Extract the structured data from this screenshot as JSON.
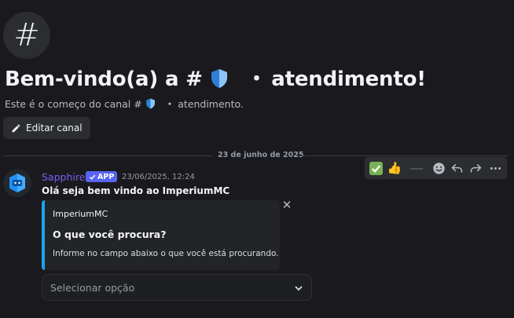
{
  "channel": {
    "hash_symbol": "#",
    "welcome_prefix": "Bem-vindo(a) a #",
    "welcome_suffix": "atendimento!",
    "subtitle_prefix": "Este é o começo do canal #",
    "subtitle_suffix": "atendimento.",
    "dot": "・",
    "edit_label": "Editar canal"
  },
  "divider": {
    "date": "23 de junho de 2025"
  },
  "message": {
    "author": "Sapphire",
    "badge": "APP",
    "timestamp": "23/06/2025, 12:24",
    "text": "Olá seja bem vindo ao ImperiumMC",
    "embed": {
      "author": "ImperiumMC",
      "title": "O que você procura?",
      "description": "Informe no campo abaixo o que você está procurando.",
      "accent_color": "#1da1f2"
    },
    "select": {
      "placeholder": "Selecionar opção"
    }
  },
  "toolbar": {
    "reactions": [
      "✅",
      "👍"
    ],
    "actions": [
      "add-reaction",
      "reply",
      "forward",
      "more"
    ]
  },
  "colors": {
    "background": "#1a1a1e",
    "username": "#7d5cf3",
    "badge": "#5865f2"
  }
}
